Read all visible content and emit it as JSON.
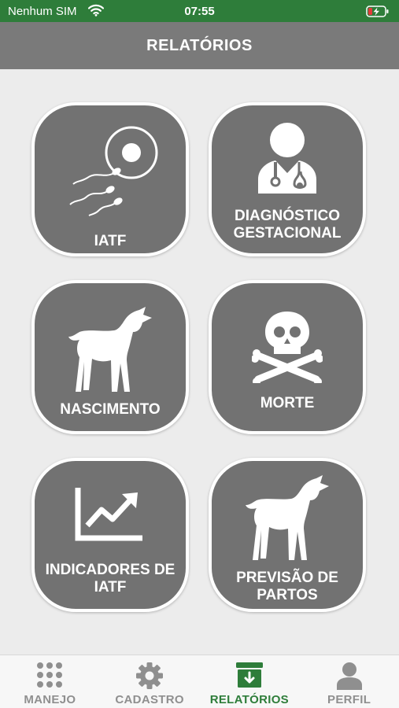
{
  "status_bar": {
    "carrier": "Nenhum SIM",
    "time": "07:55",
    "wifi_icon": "wifi-icon",
    "battery_icon": "battery-charging-icon"
  },
  "header": {
    "title": "RELATÓRIOS"
  },
  "tiles": [
    {
      "label": "IATF",
      "icon": "sperm-egg-icon"
    },
    {
      "label": "DIAGNÓSTICO GESTACIONAL",
      "icon": "doctor-icon"
    },
    {
      "label": "NASCIMENTO",
      "icon": "calf-icon"
    },
    {
      "label": "MORTE",
      "icon": "skull-crossbones-icon"
    },
    {
      "label": "INDICADORES DE IATF",
      "icon": "trending-up-chart-icon"
    },
    {
      "label": "PREVISÃO DE PARTOS",
      "icon": "calf-icon"
    }
  ],
  "tab_bar": {
    "active": "RELATÓRIOS",
    "tabs": [
      {
        "label": "MANEJO",
        "icon": "grid-dots-icon"
      },
      {
        "label": "CADASTRO",
        "icon": "gear-icon"
      },
      {
        "label": "RELATÓRIOS",
        "icon": "archive-download-icon"
      },
      {
        "label": "PERFIL",
        "icon": "user-icon"
      }
    ]
  },
  "colors": {
    "status_bar": "#2e7d3a",
    "header": "#7a7a7a",
    "tile": "#727272",
    "active_tab": "#2e7d3a",
    "inactive_tab": "#8f8f8f",
    "background": "#ececec"
  }
}
